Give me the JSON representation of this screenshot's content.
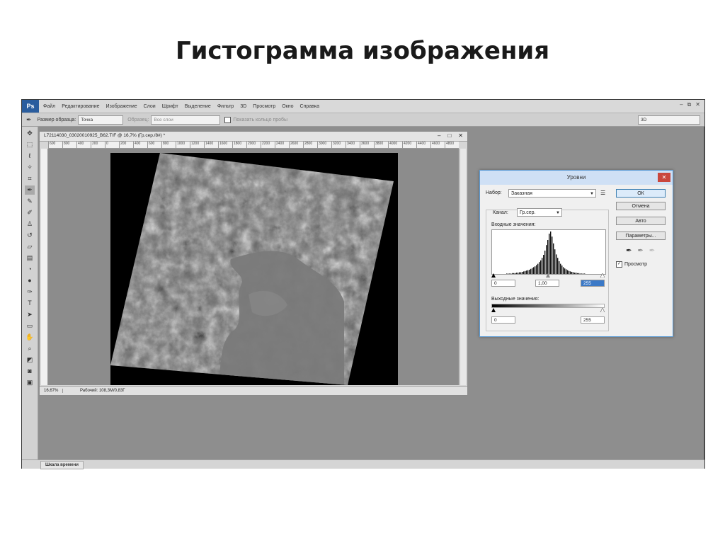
{
  "slide": {
    "title": "Гистограмма изображения"
  },
  "app": {
    "logo": "Ps",
    "menu": [
      "Файл",
      "Редактирование",
      "Изображение",
      "Слои",
      "Шрифт",
      "Выделение",
      "Фильтр",
      "3D",
      "Просмотр",
      "Окно",
      "Справка"
    ],
    "window_controls": [
      "–",
      "⧉",
      "✕"
    ]
  },
  "options_bar": {
    "sample_size_label": "Размер образца:",
    "sample_size_value": "Точка",
    "sample_label": "Образец:",
    "sample_value": "Все слои",
    "show_ring_label": "Показать кольцо пробы",
    "workspace_value": "3D"
  },
  "document": {
    "tab_title": "L72114030_03020010925_B62.TIF @ 16,7% (Гр.сер./8#) *",
    "ruler_ticks": [
      "600",
      "800",
      "400",
      "200",
      "0",
      "200",
      "400",
      "600",
      "800",
      "1000",
      "1200",
      "1400",
      "1600",
      "1800",
      "2000",
      "2200",
      "2400",
      "2600",
      "2800",
      "3000",
      "3200",
      "3400",
      "3600",
      "3800",
      "4000",
      "4200",
      "4400",
      "4600",
      "4800"
    ],
    "zoom": "16,67%",
    "status": "Рабочий: 108,3M/0,83Г"
  },
  "timeline": {
    "tab_label": "Шкала времени"
  },
  "levels": {
    "title": "Уровни",
    "preset_label": "Набор:",
    "preset_value": "Заказная",
    "channel_label": "Канал:",
    "channel_value": "Гр.сер.",
    "input_label": "Входные значения:",
    "input_black": "0",
    "input_gamma": "1,00",
    "input_white": "255",
    "output_label": "Выходные значения:",
    "output_black": "0",
    "output_white": "255",
    "buttons": {
      "ok": "ОК",
      "cancel": "Отмена",
      "auto": "Авто",
      "options": "Параметры..."
    },
    "preview_label": "Просмотр",
    "preview_checked": true
  },
  "histogram_levels": [
    0,
    0,
    0,
    0,
    0,
    0,
    0,
    0,
    0,
    0,
    1,
    1,
    1,
    1,
    2,
    2,
    2,
    3,
    3,
    4,
    4,
    5,
    6,
    7,
    8,
    9,
    10,
    12,
    14,
    16,
    18,
    21,
    24,
    28,
    32,
    38,
    45,
    55,
    68,
    80,
    95,
    100,
    88,
    72,
    58,
    46,
    38,
    30,
    24,
    20,
    16,
    13,
    11,
    9,
    7,
    6,
    5,
    4,
    3,
    3,
    2,
    2,
    1,
    1,
    1,
    1,
    0,
    0,
    0,
    0,
    0,
    0,
    0,
    0,
    0,
    0,
    0,
    0,
    0,
    0
  ]
}
